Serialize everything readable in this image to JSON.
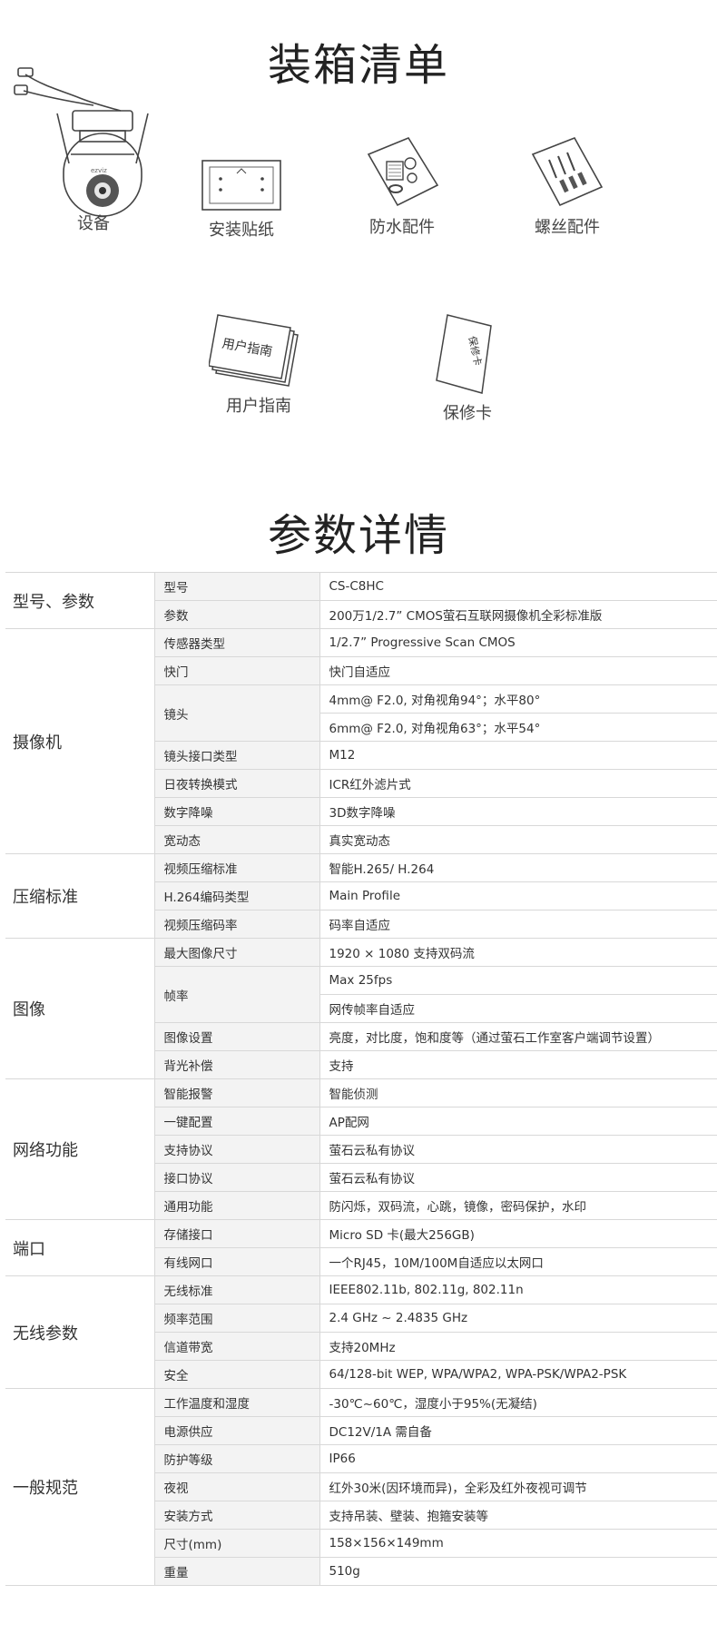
{
  "packing": {
    "title": "装箱清单",
    "items": [
      {
        "label": "设备",
        "icon": "camera-icon"
      },
      {
        "label": "安装贴纸",
        "icon": "sticker-icon"
      },
      {
        "label": "防水配件",
        "icon": "waterproof-kit-icon"
      },
      {
        "label": "螺丝配件",
        "icon": "screw-kit-icon"
      },
      {
        "label": "用户指南",
        "icon": "guide-icon"
      },
      {
        "label": "保修卡",
        "icon": "warranty-card-icon"
      }
    ],
    "guide_cover_text": "用户指南",
    "card_cover_text": "保修卡",
    "brand_mark": "ezviz"
  },
  "params": {
    "title": "参数详情",
    "groups": [
      {
        "name": "型号、参数",
        "rows": [
          {
            "k": "型号",
            "v": [
              "CS-C8HC"
            ]
          },
          {
            "k": "参数",
            "v": [
              "200万1/2.7”  CMOS萤石互联网摄像机全彩标准版"
            ]
          }
        ]
      },
      {
        "name": "摄像机",
        "rows": [
          {
            "k": "传感器类型",
            "v": [
              "1/2.7”  Progressive Scan CMOS"
            ]
          },
          {
            "k": "快门",
            "v": [
              "快门自适应"
            ]
          },
          {
            "k": "镜头",
            "v": [
              "4mm@ F2.0, 对角视角94°；水平80°",
              "6mm@ F2.0, 对角视角63°；水平54°"
            ]
          },
          {
            "k": "镜头接口类型",
            "v": [
              "M12"
            ]
          },
          {
            "k": "日夜转换模式",
            "v": [
              "ICR红外滤片式"
            ]
          },
          {
            "k": "数字降噪",
            "v": [
              "3D数字降噪"
            ]
          },
          {
            "k": "宽动态",
            "v": [
              "真实宽动态"
            ]
          }
        ]
      },
      {
        "name": "压缩标准",
        "rows": [
          {
            "k": "视频压缩标准",
            "v": [
              "智能H.265/ H.264"
            ]
          },
          {
            "k": "H.264编码类型",
            "v": [
              "Main Profile"
            ]
          },
          {
            "k": "视频压缩码率",
            "v": [
              "码率自适应"
            ]
          }
        ]
      },
      {
        "name": "图像",
        "rows": [
          {
            "k": "最大图像尺寸",
            "v": [
              "1920 × 1080 支持双码流"
            ]
          },
          {
            "k": "帧率",
            "v": [
              "Max 25fps",
              "网传帧率自适应"
            ]
          },
          {
            "k": "图像设置",
            "v": [
              "亮度，对比度，饱和度等（通过萤石工作室客户端调节设置）"
            ]
          },
          {
            "k": "背光补偿",
            "v": [
              "支持"
            ]
          }
        ]
      },
      {
        "name": "网络功能",
        "rows": [
          {
            "k": "智能报警",
            "v": [
              "智能侦测"
            ]
          },
          {
            "k": "一键配置",
            "v": [
              "AP配网"
            ]
          },
          {
            "k": "支持协议",
            "v": [
              "萤石云私有协议"
            ]
          },
          {
            "k": "接口协议",
            "v": [
              "萤石云私有协议"
            ]
          },
          {
            "k": "通用功能",
            "v": [
              "防闪烁，双码流，心跳，镜像，密码保护，水印"
            ]
          }
        ]
      },
      {
        "name": "端口",
        "rows": [
          {
            "k": "存储接口",
            "v": [
              "Micro SD 卡(最大256GB)"
            ]
          },
          {
            "k": "有线网口",
            "v": [
              "一个RJ45，10M/100M自适应以太网口"
            ]
          }
        ]
      },
      {
        "name": "无线参数",
        "rows": [
          {
            "k": "无线标准",
            "v": [
              "IEEE802.11b, 802.11g, 802.11n"
            ]
          },
          {
            "k": "频率范围",
            "v": [
              "2.4 GHz ~ 2.4835 GHz"
            ]
          },
          {
            "k": "信道带宽",
            "v": [
              "支持20MHz"
            ]
          },
          {
            "k": "安全",
            "v": [
              "64/128-bit WEP, WPA/WPA2, WPA-PSK/WPA2-PSK"
            ]
          }
        ]
      },
      {
        "name": "一般规范",
        "rows": [
          {
            "k": "工作温度和湿度",
            "v": [
              "-30℃~60℃，湿度小于95%(无凝结)"
            ]
          },
          {
            "k": "电源供应",
            "v": [
              "DC12V/1A 需自备"
            ]
          },
          {
            "k": "防护等级",
            "v": [
              "IP66"
            ]
          },
          {
            "k": "夜视",
            "v": [
              "红外30米(因环境而异)，全彩及红外夜视可调节"
            ]
          },
          {
            "k": "安装方式",
            "v": [
              "支持吊装、壁装、抱箍安装等"
            ]
          },
          {
            "k": "尺寸(mm)",
            "v": [
              "158×156×149mm"
            ]
          },
          {
            "k": "重量",
            "v": [
              "510g"
            ]
          }
        ]
      }
    ]
  }
}
